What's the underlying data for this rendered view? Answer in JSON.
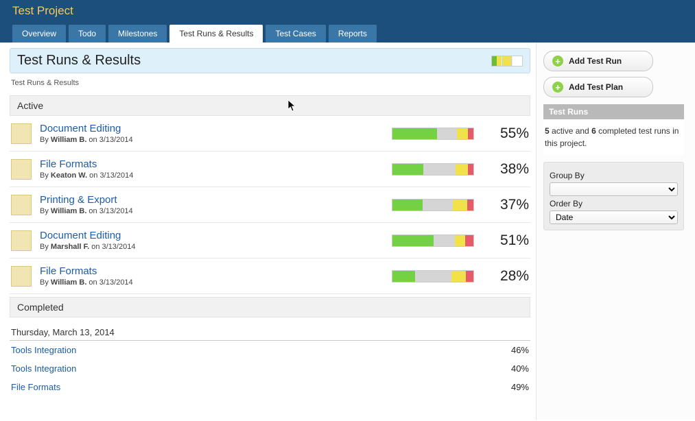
{
  "header": {
    "project_title": "Test Project",
    "tabs": [
      {
        "label": "Overview",
        "active": false
      },
      {
        "label": "Todo",
        "active": false
      },
      {
        "label": "Milestones",
        "active": false
      },
      {
        "label": "Test Runs & Results",
        "active": true
      },
      {
        "label": "Test Cases",
        "active": false
      },
      {
        "label": "Reports",
        "active": false
      }
    ]
  },
  "page": {
    "title": "Test Runs & Results",
    "breadcrumb": "Test Runs & Results"
  },
  "sections": {
    "active_label": "Active",
    "completed_label": "Completed"
  },
  "active_runs": [
    {
      "name": "Document Editing",
      "author": "William B.",
      "date": "3/13/2014",
      "pct": "55%",
      "bars": {
        "green": 55,
        "grey": 25,
        "yellow": 13,
        "red": 7
      }
    },
    {
      "name": "File Formats",
      "author": "Keaton W.",
      "date": "3/13/2014",
      "pct": "38%",
      "bars": {
        "green": 38,
        "grey": 40,
        "yellow": 15,
        "red": 7
      }
    },
    {
      "name": "Printing & Export",
      "author": "William B.",
      "date": "3/13/2014",
      "pct": "37%",
      "bars": {
        "green": 37,
        "grey": 38,
        "yellow": 17,
        "red": 8
      }
    },
    {
      "name": "Document Editing",
      "author": "Marshall F.",
      "date": "3/13/2014",
      "pct": "51%",
      "bars": {
        "green": 51,
        "grey": 26,
        "yellow": 13,
        "red": 10
      }
    },
    {
      "name": "File Formats",
      "author": "William B.",
      "date": "3/13/2014",
      "pct": "28%",
      "bars": {
        "green": 28,
        "grey": 45,
        "yellow": 18,
        "red": 9
      }
    }
  ],
  "completed": {
    "date_heading": "Thursday, March 13, 2014",
    "runs": [
      {
        "name": "Tools Integration",
        "pct": "46%"
      },
      {
        "name": "Tools Integration",
        "pct": "40%"
      },
      {
        "name": "File Formats",
        "pct": "49%"
      }
    ]
  },
  "sidebar": {
    "add_run_label": "Add Test Run",
    "add_plan_label": "Add Test Plan",
    "panel_head": "Test Runs",
    "summary_prefix": "5",
    "summary_mid": " active and ",
    "summary_count2": "6",
    "summary_suffix": " completed test runs in this project.",
    "group_by_label": "Group By",
    "group_by_value": "",
    "order_by_label": "Order By",
    "order_by_value": "Date"
  }
}
